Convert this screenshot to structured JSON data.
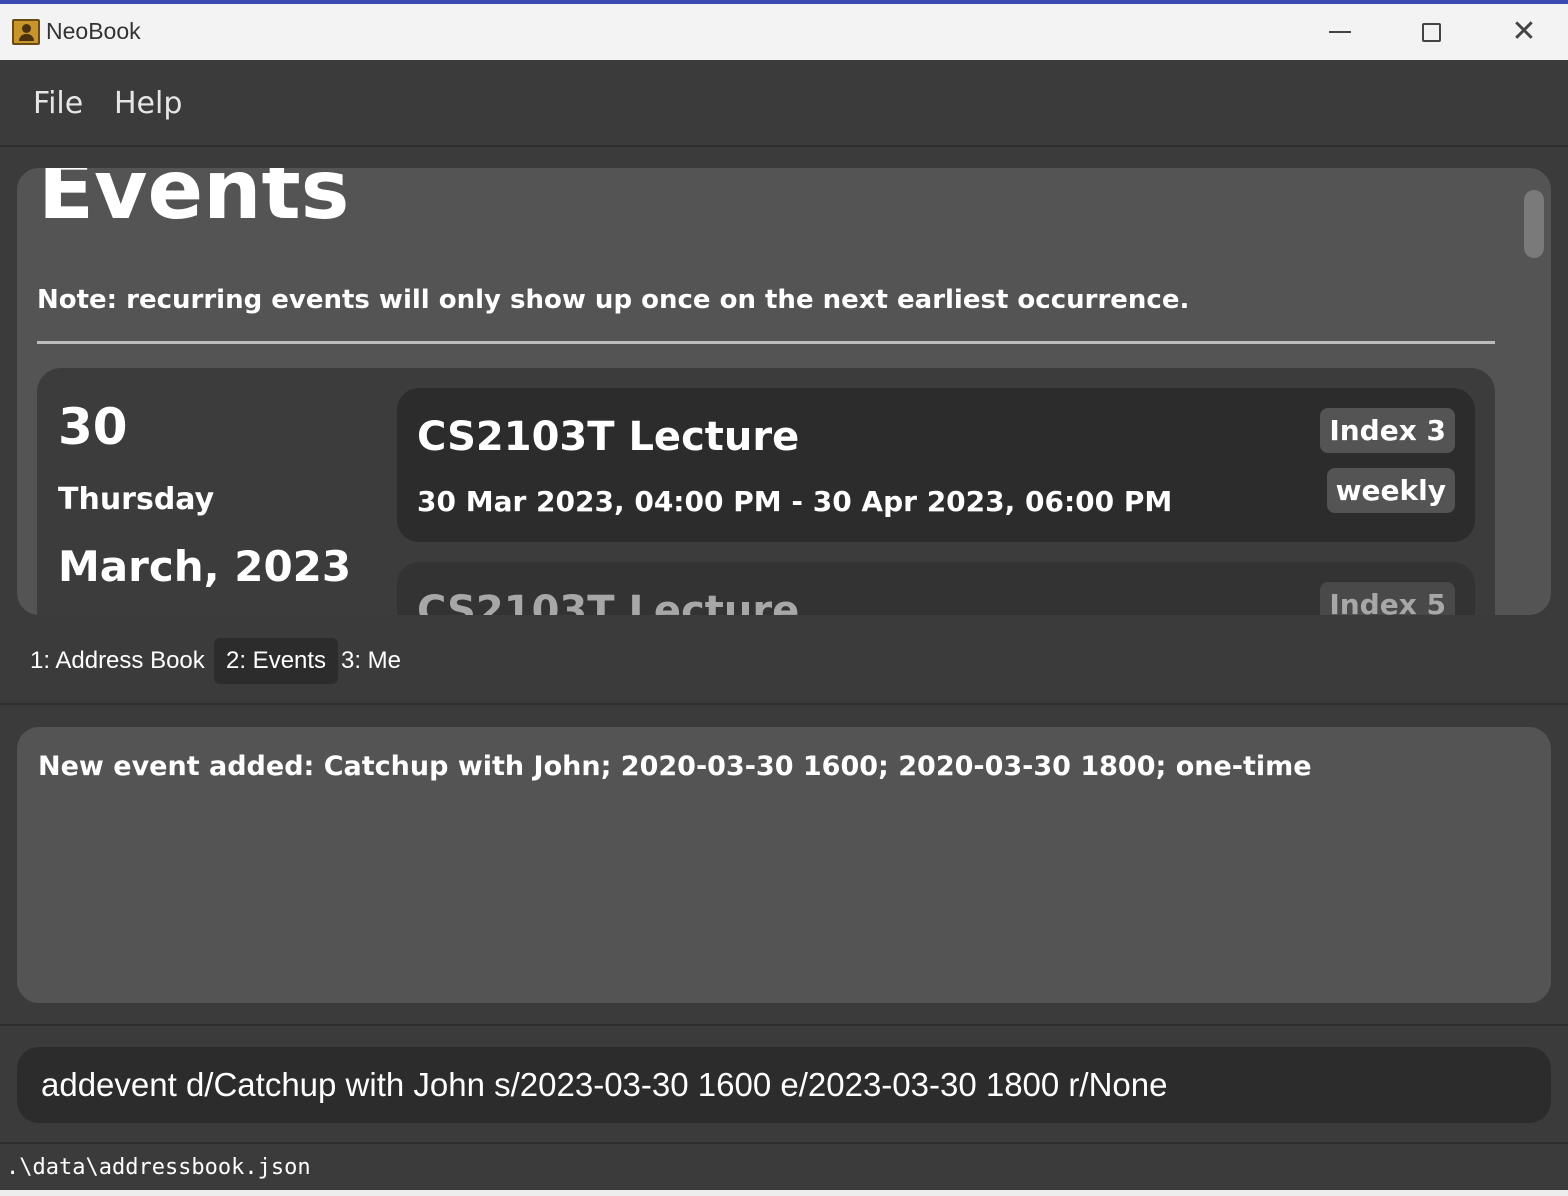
{
  "window": {
    "title": "NeoBook",
    "close_glyph": "✕"
  },
  "menu": {
    "file": "File",
    "help": "Help"
  },
  "events": {
    "title": "Events",
    "note": "Note: recurring events will only show up once on the next earliest occurrence.",
    "date_group": {
      "day": "30",
      "weekday": "Thursday",
      "month_year": "March, 2023"
    },
    "cards": [
      {
        "name": "CS2103T Lecture",
        "time": "30 Mar 2023, 04:00 PM - 30 Apr 2023, 06:00 PM",
        "index": "Index 3",
        "recurrence": "weekly"
      },
      {
        "name": "CS2103T Lecture",
        "index": "Index 5"
      }
    ]
  },
  "tabs": [
    {
      "label": "1: Address Book",
      "active": false
    },
    {
      "label": "2: Events",
      "active": true
    },
    {
      "label": "3: Me",
      "active": false
    }
  ],
  "result": {
    "text": "New event added: Catchup with John; 2020-03-30 1600; 2020-03-30 1800; one-time"
  },
  "command": {
    "value": "addevent d/Catchup with John s/2023-03-30 1600 e/2023-03-30 1800 r/None"
  },
  "status": {
    "path": ".\\data\\addressbook.json"
  },
  "colors": {
    "background": "#3b3b3b",
    "panel": "#545454",
    "card": "#2c2c2c",
    "titlebar": "#f3f3f3",
    "text": "#ffffff"
  }
}
